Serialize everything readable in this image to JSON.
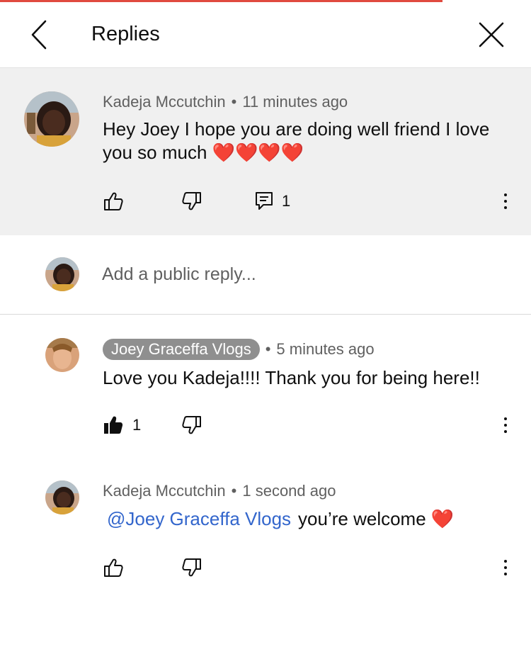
{
  "header": {
    "title": "Replies"
  },
  "parent_comment": {
    "author": "Kadeja Mccutchin",
    "time": "11 minutes ago",
    "text": "Hey Joey I hope you are doing well friend I love you so much",
    "hearts": "❤️❤️❤️❤️",
    "reply_count": "1"
  },
  "reply_box": {
    "placeholder": "Add a public reply..."
  },
  "replies": [
    {
      "author": "Joey Graceffa Vlogs",
      "time": "5 minutes ago",
      "text": "Love you Kadeja!!!! Thank you for being here!!",
      "like_count": "1"
    },
    {
      "author": "Kadeja Mccutchin",
      "time": "1 second ago",
      "mention": "@Joey Graceffa Vlogs",
      "text": "you’re welcome",
      "heart": "❤️"
    }
  ],
  "separator": "•",
  "colors": {
    "accent_red": "#e04a3f",
    "mention_blue": "#3366cc",
    "parent_bg": "#f0f0f0",
    "creator_chip": "#8f8f8f"
  },
  "icons": {
    "back": "chevron-left-icon",
    "close": "close-icon",
    "like": "thumbs-up-icon",
    "liked": "thumbs-up-filled-icon",
    "dislike": "thumbs-down-icon",
    "reply": "comment-icon",
    "more": "more-vertical-icon"
  }
}
